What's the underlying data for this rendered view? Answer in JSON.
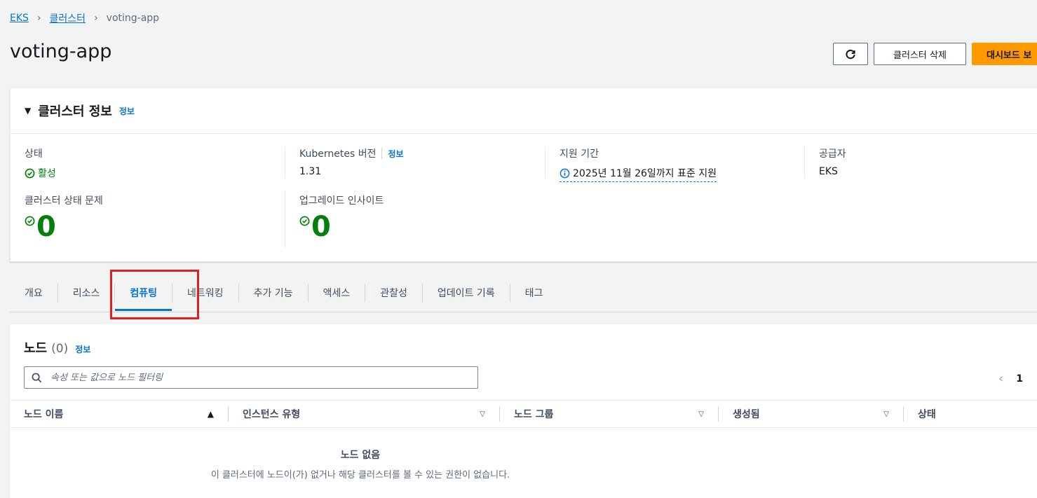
{
  "breadcrumb": {
    "items": [
      "EKS",
      "클러스터"
    ],
    "current": "voting-app"
  },
  "page": {
    "title": "voting-app"
  },
  "header_actions": {
    "refresh_icon": "refresh-icon",
    "delete_label": "클러스터 삭제",
    "dashboard_label": "대시보드 보"
  },
  "cluster_info": {
    "title": "클러스터 정보",
    "info_link": "정보",
    "status_label": "상태",
    "status_value": "활성",
    "k8s_label": "Kubernetes 버전",
    "k8s_info": "정보",
    "k8s_value": "1.31",
    "support_label": "지원 기간",
    "support_value": "2025년 11월 26일까지 표준 지원",
    "provider_label": "공급자",
    "provider_value": "EKS",
    "issues_label": "클러스터 상태 문제",
    "issues_value": "0",
    "insights_label": "업그레이드 인사이트",
    "insights_value": "0"
  },
  "tabs": [
    "개요",
    "리소스",
    "컴퓨팅",
    "네트워킹",
    "추가 기능",
    "액세스",
    "관찰성",
    "업데이트 기록",
    "태그"
  ],
  "active_tab": "컴퓨팅",
  "nodes": {
    "title": "노드",
    "count": "(0)",
    "info_link": "정보",
    "filter_placeholder": "속성 또는 값으로 노드 필터링",
    "page": "1",
    "columns": [
      "노드 이름",
      "인스턴스 유형",
      "노드 그룹",
      "생성됨",
      "상태"
    ],
    "empty_title": "노드 없음",
    "empty_desc": "이 클러스터에 노드이(가) 없거나 해당 클러스터를 볼 수 있는 권한이 없습니다."
  },
  "colors": {
    "accent": "#0972d3",
    "success": "#037f0c",
    "primary_button": "#ff9900",
    "highlight": "#e02020"
  }
}
